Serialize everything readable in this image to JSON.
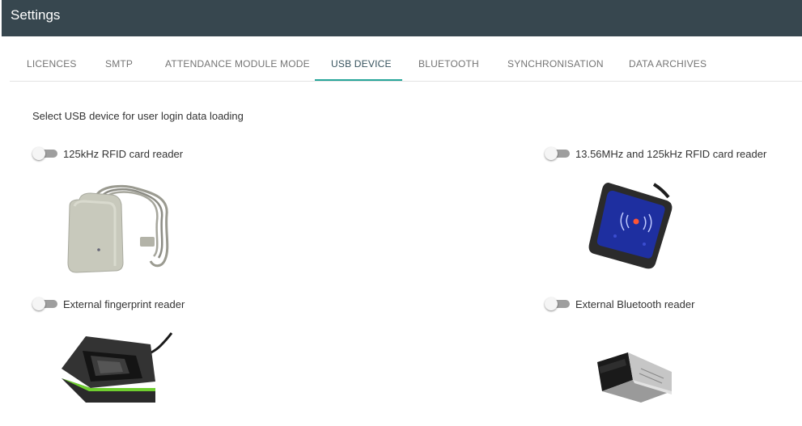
{
  "window": {
    "title": "Settings"
  },
  "tabs": [
    {
      "label": "LICENCES",
      "active": false
    },
    {
      "label": "SMTP",
      "active": false
    },
    {
      "label": "ATTENDANCE MODULE MODE",
      "active": false
    },
    {
      "label": "USB DEVICE",
      "active": true
    },
    {
      "label": "BLUETOOTH",
      "active": false
    },
    {
      "label": "SYNCHRONISATION",
      "active": false
    },
    {
      "label": "DATA ARCHIVES",
      "active": false
    }
  ],
  "colors": {
    "title_bar": "#37474f",
    "active_tab_indicator": "#26a69a",
    "toggle_off_track": "#9e9e9e",
    "toggle_thumb": "#f5f5f5"
  },
  "main": {
    "instruction": "Select USB device for user login data loading",
    "devices": [
      {
        "label": "125kHz RFID card reader",
        "enabled": false,
        "image": "usb-rfid-reader-beige"
      },
      {
        "label": "13.56MHz and 125kHz RFID card reader",
        "enabled": false,
        "image": "nfc-rfid-reader-black"
      },
      {
        "label": "External fingerprint reader",
        "enabled": false,
        "image": "fingerprint-scanner"
      },
      {
        "label": "External Bluetooth reader",
        "enabled": false,
        "image": "bluetooth-usb-dongle"
      }
    ]
  }
}
